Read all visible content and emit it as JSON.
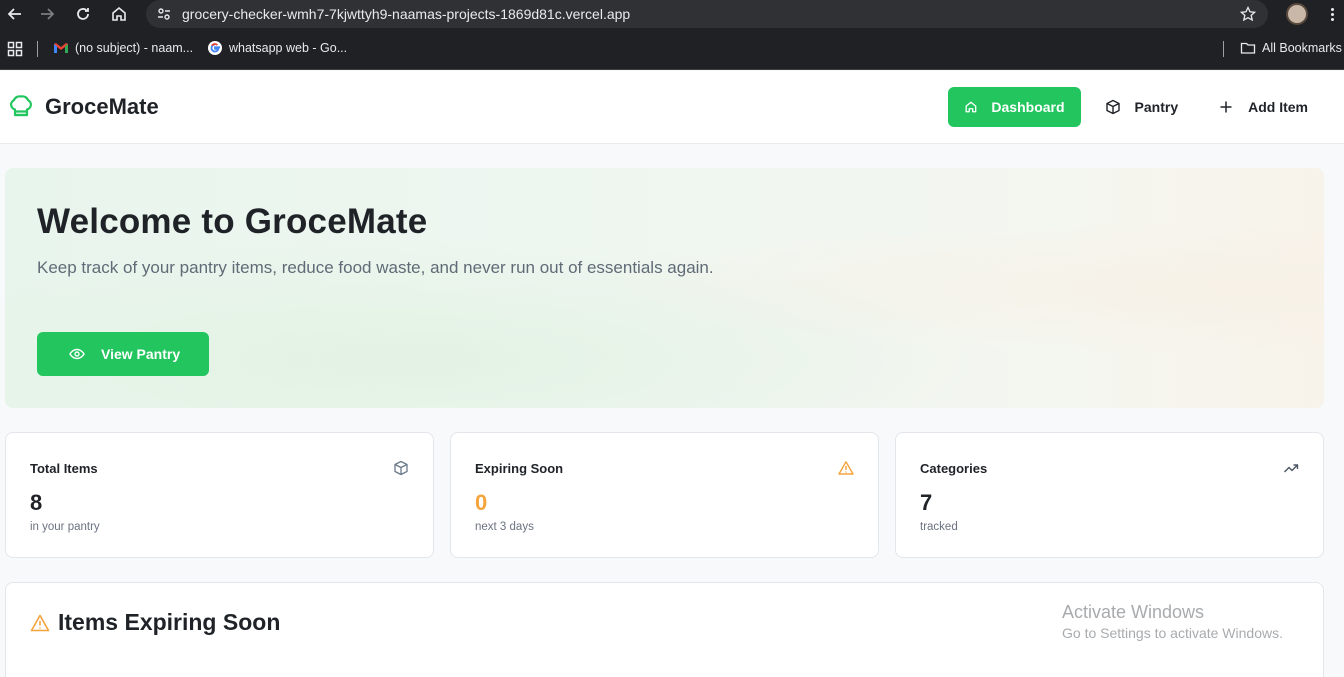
{
  "browser": {
    "url": "grocery-checker-wmh7-7kjwttyh9-naamas-projects-1869d81c.vercel.app",
    "bookmarks": [
      {
        "label": "(no subject) - naam...",
        "icon": "gmail-icon"
      },
      {
        "label": "whatsapp web - Go...",
        "icon": "google-icon"
      }
    ],
    "all_bookmarks_label": "All Bookmarks"
  },
  "app": {
    "name": "GroceMate",
    "nav": [
      {
        "label": "Dashboard",
        "icon": "home-icon",
        "active": true
      },
      {
        "label": "Pantry",
        "icon": "package-icon",
        "active": false
      },
      {
        "label": "Add Item",
        "icon": "plus-icon",
        "active": false
      }
    ]
  },
  "hero": {
    "title": "Welcome to GroceMate",
    "subtitle": "Keep track of your pantry items, reduce food waste, and never run out of essentials again.",
    "button_label": "View Pantry"
  },
  "stats": [
    {
      "title": "Total Items",
      "value": "8",
      "sub": "in your pantry",
      "icon": "package-icon"
    },
    {
      "title": "Expiring Soon",
      "value": "0",
      "sub": "next 3 days",
      "icon": "warning-icon"
    },
    {
      "title": "Categories",
      "value": "7",
      "sub": "tracked",
      "icon": "trending-up-icon"
    }
  ],
  "expiring_section": {
    "title": "Items Expiring Soon"
  },
  "watermark": {
    "line1": "Activate Windows",
    "line2": "Go to Settings to activate Windows."
  },
  "colors": {
    "accent": "#22c55e",
    "warning": "#f5a33b"
  }
}
